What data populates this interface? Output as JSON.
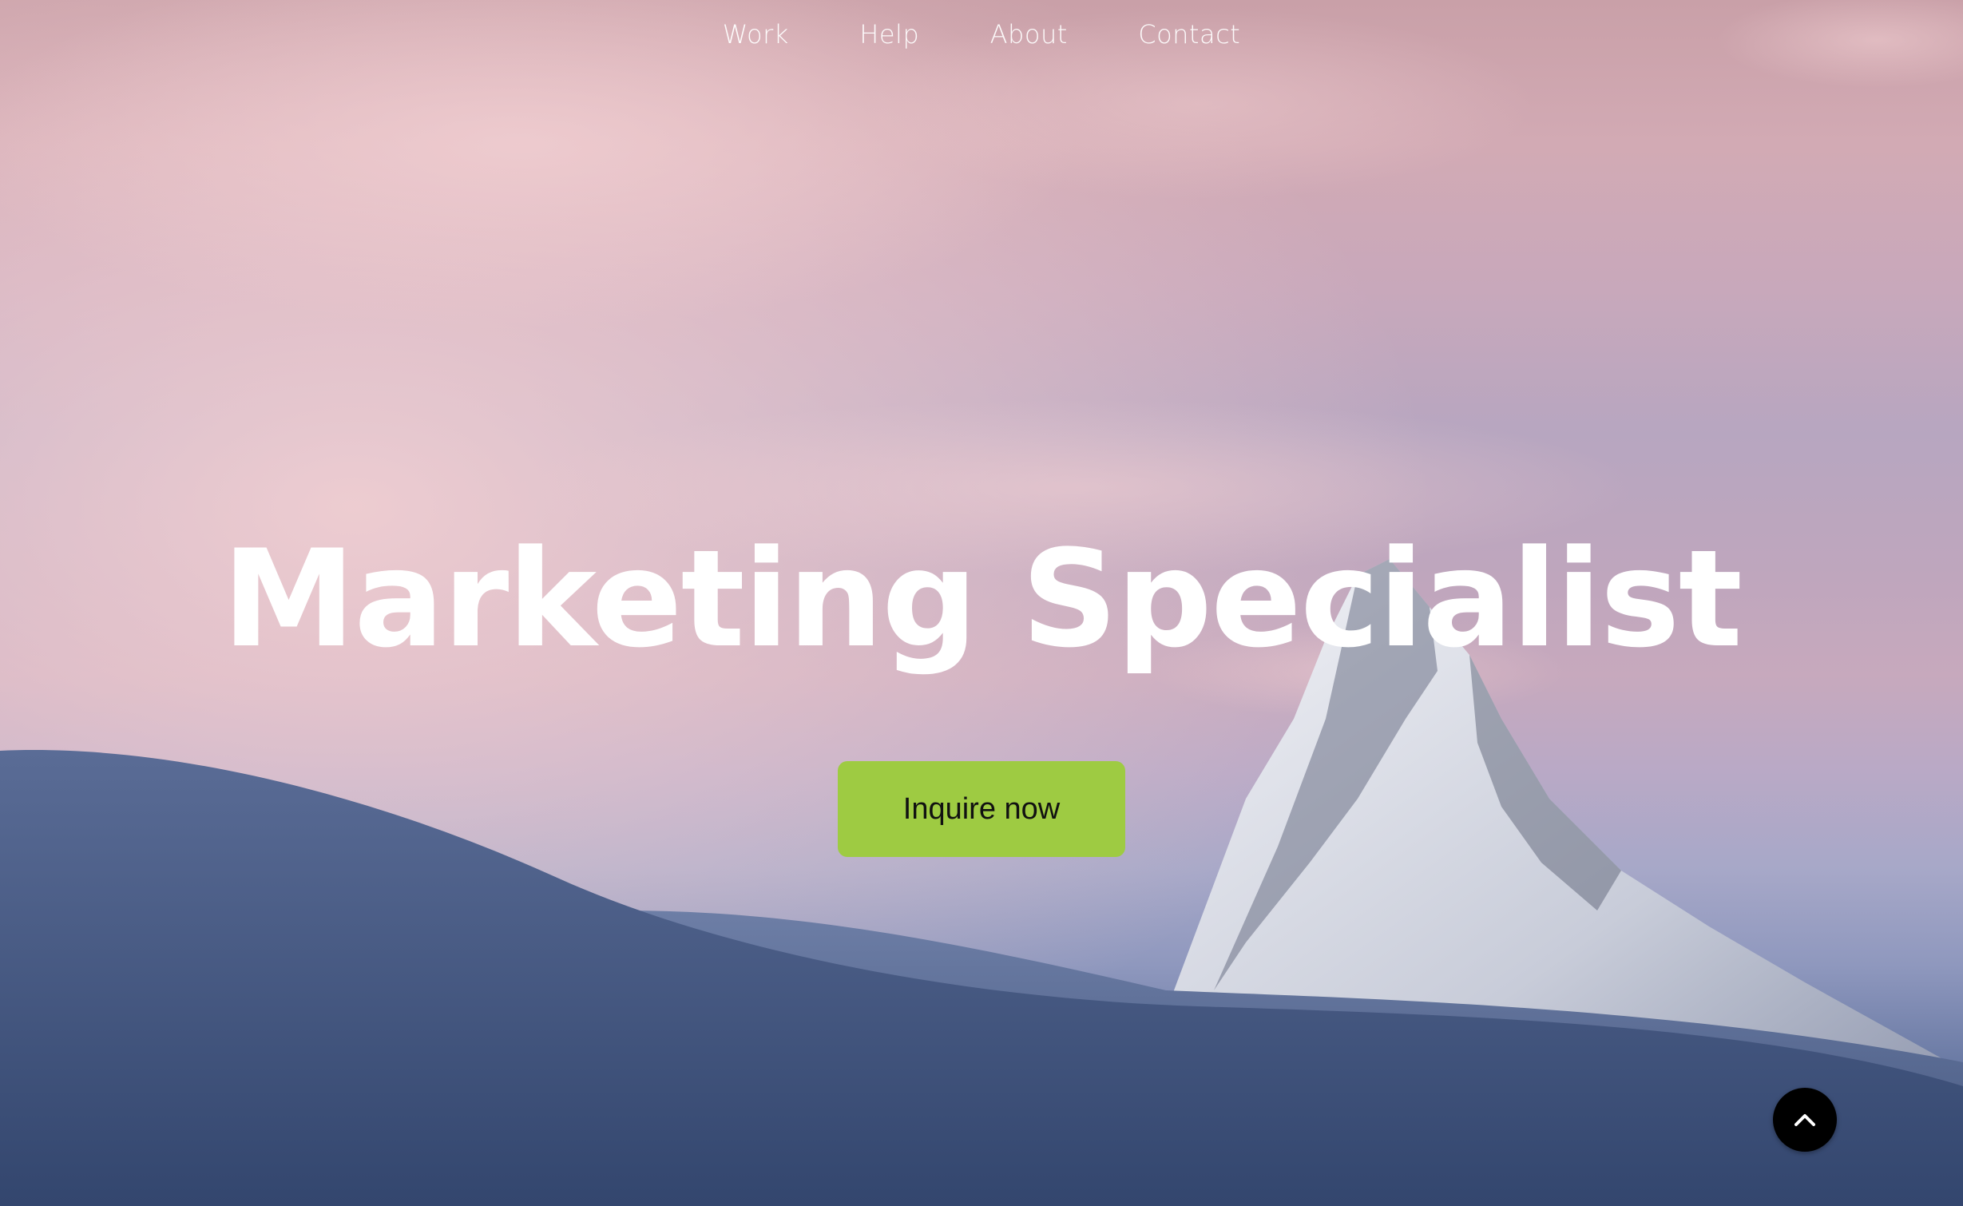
{
  "nav": {
    "items": [
      {
        "label": "Work"
      },
      {
        "label": "Help"
      },
      {
        "label": "About"
      },
      {
        "label": "Contact"
      }
    ]
  },
  "hero": {
    "headline": "Marketing Specialist",
    "cta_label": "Inquire now"
  },
  "scroll_top": {
    "icon": "chevron-up-icon"
  },
  "colors": {
    "cta_background": "#9ecb42",
    "scroll_top_background": "#000000",
    "text": "#ffffff"
  }
}
